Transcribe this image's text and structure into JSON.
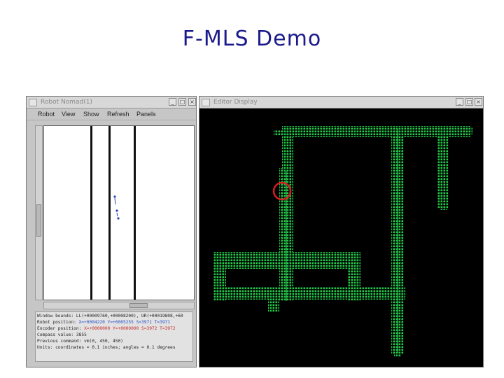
{
  "slide": {
    "title": "F-MLS Demo"
  },
  "left_window": {
    "title": "Robot Nomad(1)",
    "menu": [
      "Robot",
      "View",
      "Show",
      "Refresh",
      "Panels"
    ],
    "info_lines": [
      {
        "label": "Window bounds: ",
        "value": "LL(+00009760,+00008200), UR(+00019808,+60",
        "color": "black"
      },
      {
        "label": "Robot  position: ",
        "value": "X=+0004220 Y=+0005255 S=3971 T=3971",
        "color": "blue"
      },
      {
        "label": "Encoder position: ",
        "value": "X=+0000000 Y=+0000000 S=3972 T=3972",
        "color": "red"
      },
      {
        "label": "Compass value: ",
        "value": "3855",
        "color": "black"
      },
      {
        "label": "Previous command: ",
        "value": "vm(0, 450, 450)",
        "color": "black"
      },
      {
        "label": "Units: ",
        "value": "coordinates = 0.1 inches; angles = 0.1 degrees",
        "color": "black"
      }
    ]
  },
  "right_window": {
    "title": "Editor Display"
  },
  "colors": {
    "map_green": "#22c84a",
    "highlight_circle": "#d42020",
    "title_color": "#1a1a8c"
  },
  "icons": {
    "minimize": "minimize-icon",
    "maximize": "maximize-icon",
    "close": "close-icon"
  }
}
